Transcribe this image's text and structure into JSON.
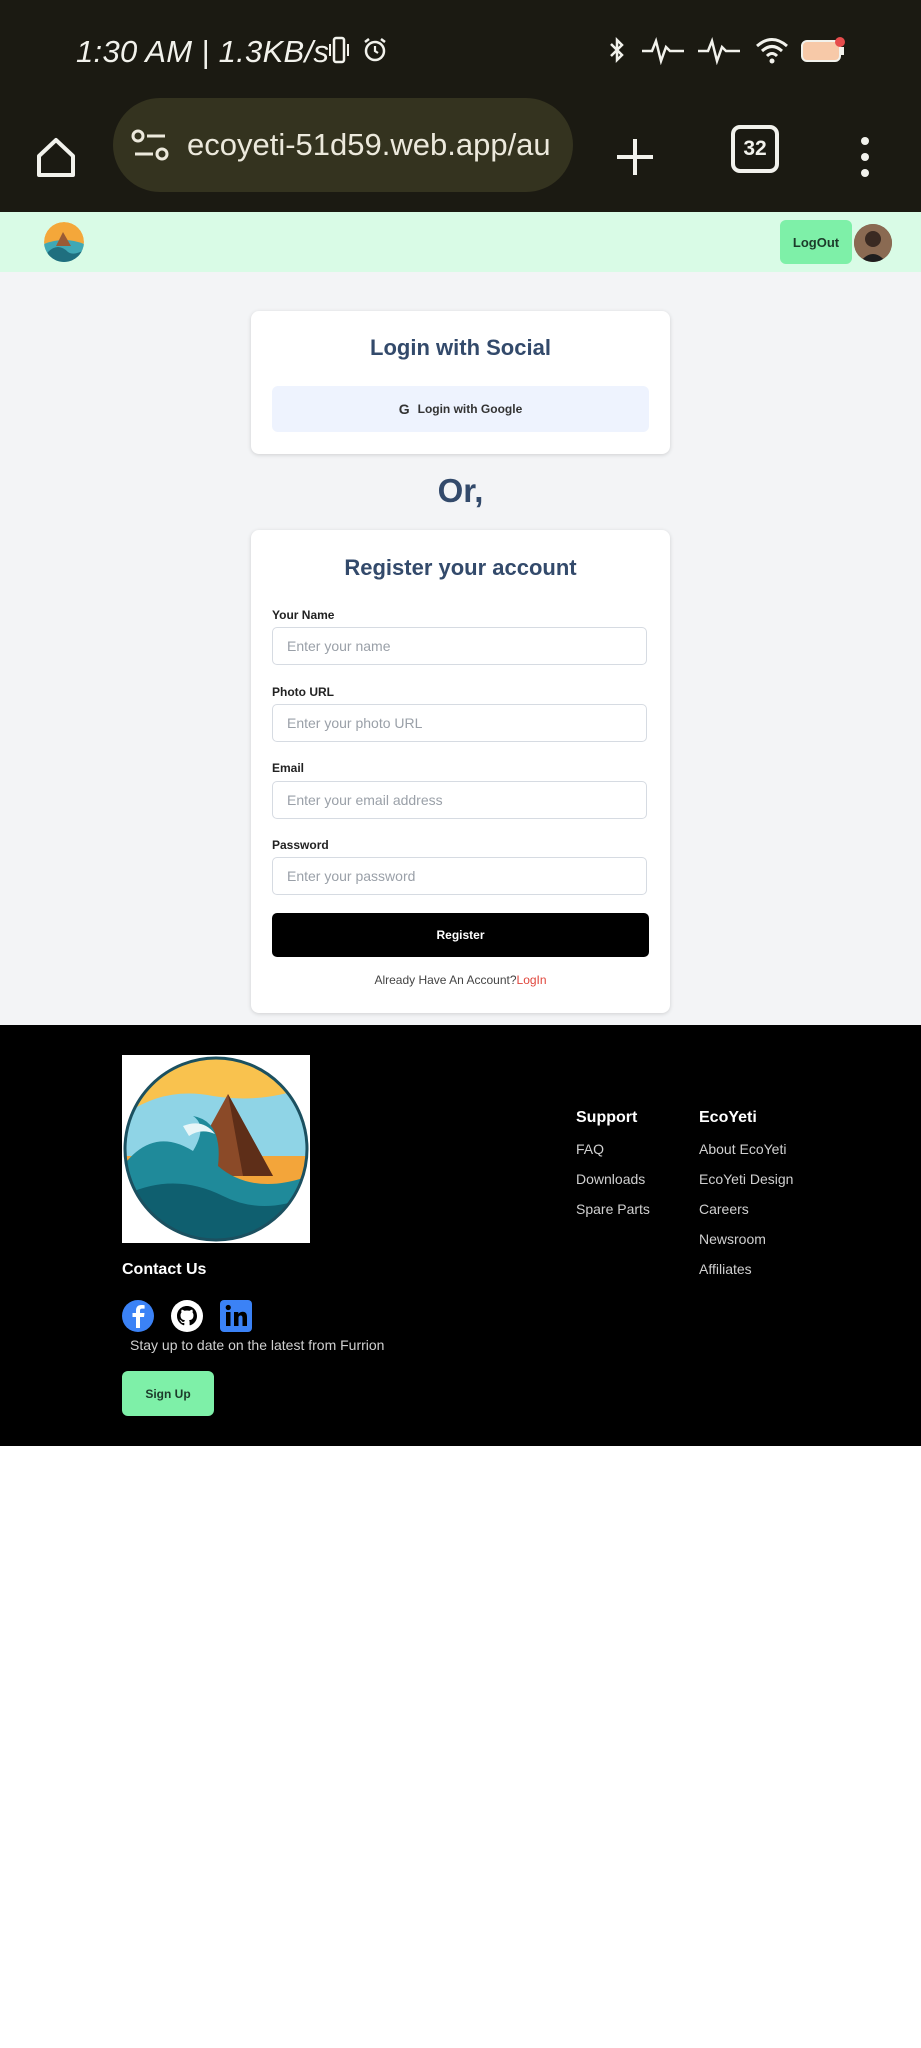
{
  "status_bar": {
    "time": "1:30 AM | 1.3KB/s",
    "battery": "80"
  },
  "browser": {
    "url": "ecoyeti-51d59.web.app/au",
    "tab_count": "32"
  },
  "header": {
    "logout_label": "LogOut"
  },
  "social_login": {
    "title": "Login with Social",
    "google_label": "Login with Google"
  },
  "divider_text": "Or,",
  "register": {
    "title": "Register your account",
    "fields": [
      {
        "label": "Your Name",
        "placeholder": "Enter your name"
      },
      {
        "label": "Photo URL",
        "placeholder": "Enter your photo URL"
      },
      {
        "label": "Email",
        "placeholder": "Enter your email address"
      },
      {
        "label": "Password",
        "placeholder": "Enter your password"
      }
    ],
    "submit_label": "Register",
    "have_account_text": "Already Have An Account?",
    "login_link": "LogIn"
  },
  "footer": {
    "contact_title": "Contact Us",
    "stay_text": "Stay up to date on the latest from Furrion",
    "signup_label": "Sign Up",
    "support": {
      "title": "Support",
      "links": [
        "FAQ",
        "Downloads",
        "Spare Parts"
      ]
    },
    "ecoyeti": {
      "title": "EcoYeti",
      "links": [
        "About EcoYeti",
        "EcoYeti Design",
        "Careers",
        "Newsroom",
        "Affiliates"
      ]
    }
  },
  "colors": {
    "accent_green": "#7ef0a8",
    "header_bg": "#d9fbe6",
    "title_blue": "#334a6b",
    "login_link_red": "#e0453b"
  }
}
